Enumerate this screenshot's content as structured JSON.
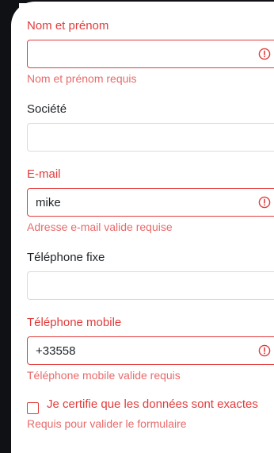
{
  "form": {
    "full_name": {
      "label": "Nom et prénom",
      "value": "",
      "error": "Nom et prénom requis"
    },
    "company": {
      "label": "Société",
      "value": ""
    },
    "email": {
      "label": "E-mail",
      "value": "mike",
      "error": "Adresse e-mail valide requise"
    },
    "landline": {
      "label": "Téléphone fixe",
      "value": ""
    },
    "mobile": {
      "label": "Téléphone mobile",
      "value": "+33558",
      "error": "Téléphone mobile valide requis"
    },
    "certify": {
      "label": "Je certifie que les données sont exactes",
      "checked": false,
      "error": "Requis pour valider le formulaire"
    }
  },
  "colors": {
    "error": "#e23b3b",
    "error_text": "#e86a6a",
    "border": "#d7dbe0",
    "text": "#1f2328"
  },
  "icons": {
    "field_error": "exclamation-circle-icon"
  }
}
